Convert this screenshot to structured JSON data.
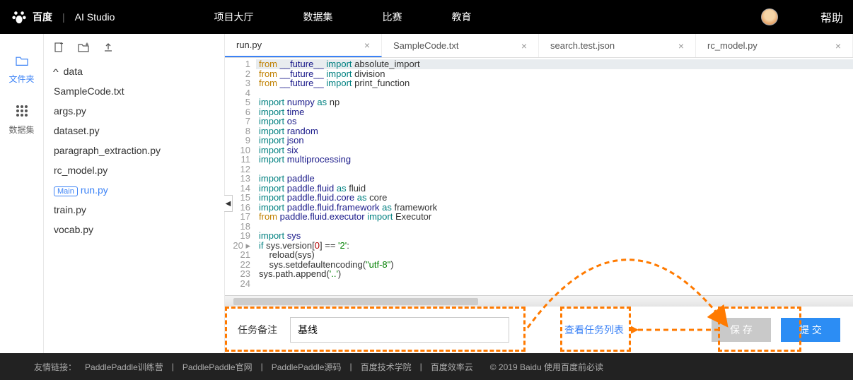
{
  "header": {
    "brand_cn": "百度",
    "brand_studio": "AI Studio",
    "nav": [
      "项目大厅",
      "数据集",
      "比赛",
      "教育"
    ],
    "help": "帮助"
  },
  "rail": {
    "files": {
      "label": "文件夹"
    },
    "datasets": {
      "label": "数据集"
    }
  },
  "tree": {
    "root": "data",
    "files": [
      "SampleCode.txt",
      "args.py",
      "dataset.py",
      "paragraph_extraction.py",
      "rc_model.py",
      "run.py",
      "train.py",
      "vocab.py"
    ],
    "main_badge": "Main",
    "current": "run.py"
  },
  "tabs": [
    "run.py",
    "SampleCode.txt",
    "search.test.json",
    "rc_model.py"
  ],
  "active_tab": "run.py",
  "gutter_expand_line": "20",
  "code": [
    {
      "t": "from __future__ import absolute_import",
      "p": [
        [
          "from",
          "k-from"
        ],
        [
          " __future__ ",
          "mod"
        ],
        [
          "import",
          "k-imp"
        ],
        [
          " absolute_import",
          "id"
        ]
      ]
    },
    {
      "t": "from __future__ import division",
      "p": [
        [
          "from",
          "k-from"
        ],
        [
          " __future__ ",
          "mod"
        ],
        [
          "import",
          "k-imp"
        ],
        [
          " division",
          "id"
        ]
      ]
    },
    {
      "t": "from __future__ import print_function",
      "p": [
        [
          "from",
          "k-from"
        ],
        [
          " __future__ ",
          "mod"
        ],
        [
          "import",
          "k-imp"
        ],
        [
          " print_function",
          "id"
        ]
      ]
    },
    {
      "t": ""
    },
    {
      "t": "import numpy as np",
      "p": [
        [
          "import",
          "k-imp"
        ],
        [
          " numpy ",
          "mod"
        ],
        [
          "as",
          "k-as"
        ],
        [
          " np",
          "id"
        ]
      ]
    },
    {
      "t": "import time",
      "p": [
        [
          "import",
          "k-imp"
        ],
        [
          " time",
          "mod"
        ]
      ]
    },
    {
      "t": "import os",
      "p": [
        [
          "import",
          "k-imp"
        ],
        [
          " os",
          "mod"
        ]
      ]
    },
    {
      "t": "import random",
      "p": [
        [
          "import",
          "k-imp"
        ],
        [
          " random",
          "mod"
        ]
      ]
    },
    {
      "t": "import json",
      "p": [
        [
          "import",
          "k-imp"
        ],
        [
          " json",
          "mod"
        ]
      ]
    },
    {
      "t": "import six",
      "p": [
        [
          "import",
          "k-imp"
        ],
        [
          " six",
          "mod"
        ]
      ]
    },
    {
      "t": "import multiprocessing",
      "p": [
        [
          "import",
          "k-imp"
        ],
        [
          " multiprocessing",
          "mod"
        ]
      ]
    },
    {
      "t": ""
    },
    {
      "t": "import paddle",
      "p": [
        [
          "import",
          "k-imp"
        ],
        [
          " paddle",
          "mod"
        ]
      ]
    },
    {
      "t": "import paddle.fluid as fluid",
      "p": [
        [
          "import",
          "k-imp"
        ],
        [
          " paddle.fluid ",
          "mod"
        ],
        [
          "as",
          "k-as"
        ],
        [
          " fluid",
          "id"
        ]
      ]
    },
    {
      "t": "import paddle.fluid.core as core",
      "p": [
        [
          "import",
          "k-imp"
        ],
        [
          " paddle.fluid.core ",
          "mod"
        ],
        [
          "as",
          "k-as"
        ],
        [
          " core",
          "id"
        ]
      ]
    },
    {
      "t": "import paddle.fluid.framework as framework",
      "p": [
        [
          "import",
          "k-imp"
        ],
        [
          " paddle.fluid.framework ",
          "mod"
        ],
        [
          "as",
          "k-as"
        ],
        [
          " framework",
          "id"
        ]
      ]
    },
    {
      "t": "from paddle.fluid.executor import Executor",
      "p": [
        [
          "from",
          "k-from"
        ],
        [
          " paddle.fluid.executor ",
          "mod"
        ],
        [
          "import",
          "k-imp"
        ],
        [
          " Executor",
          "id"
        ]
      ]
    },
    {
      "t": ""
    },
    {
      "t": "import sys",
      "p": [
        [
          "import",
          "k-imp"
        ],
        [
          " sys",
          "mod"
        ]
      ]
    },
    {
      "t": "if sys.version[0] == '2':",
      "p": [
        [
          "if ",
          "k-imp"
        ],
        [
          "sys.version[",
          "id"
        ],
        [
          "0",
          "num"
        ],
        [
          "] == ",
          "op"
        ],
        [
          "'2'",
          "str"
        ],
        [
          ":",
          "op"
        ]
      ]
    },
    {
      "t": "    reload(sys)",
      "p": [
        [
          "    reload(sys)",
          "id"
        ]
      ]
    },
    {
      "t": "    sys.setdefaultencoding(\"utf-8\")",
      "p": [
        [
          "    sys.setdefaultencoding(",
          "id"
        ],
        [
          "\"utf-8\"",
          "str"
        ],
        [
          ")",
          "id"
        ]
      ]
    },
    {
      "t": "sys.path.append('..')",
      "p": [
        [
          "sys.path.append(",
          "id"
        ],
        [
          "'..'",
          "str"
        ],
        [
          ")",
          "id"
        ]
      ]
    },
    {
      "t": ""
    }
  ],
  "bottom": {
    "label": "任务备注",
    "input_value": "基线",
    "link": "查看任务列表",
    "save": "保 存",
    "submit": "提 交"
  },
  "footer": {
    "prefix": "友情链接：",
    "links": [
      "PaddlePaddle训练营",
      "PaddlePaddle官网",
      "PaddlePaddle源码",
      "百度技术学院",
      "百度效率云"
    ],
    "copyright": "© 2019 Baidu 使用百度前必读"
  }
}
